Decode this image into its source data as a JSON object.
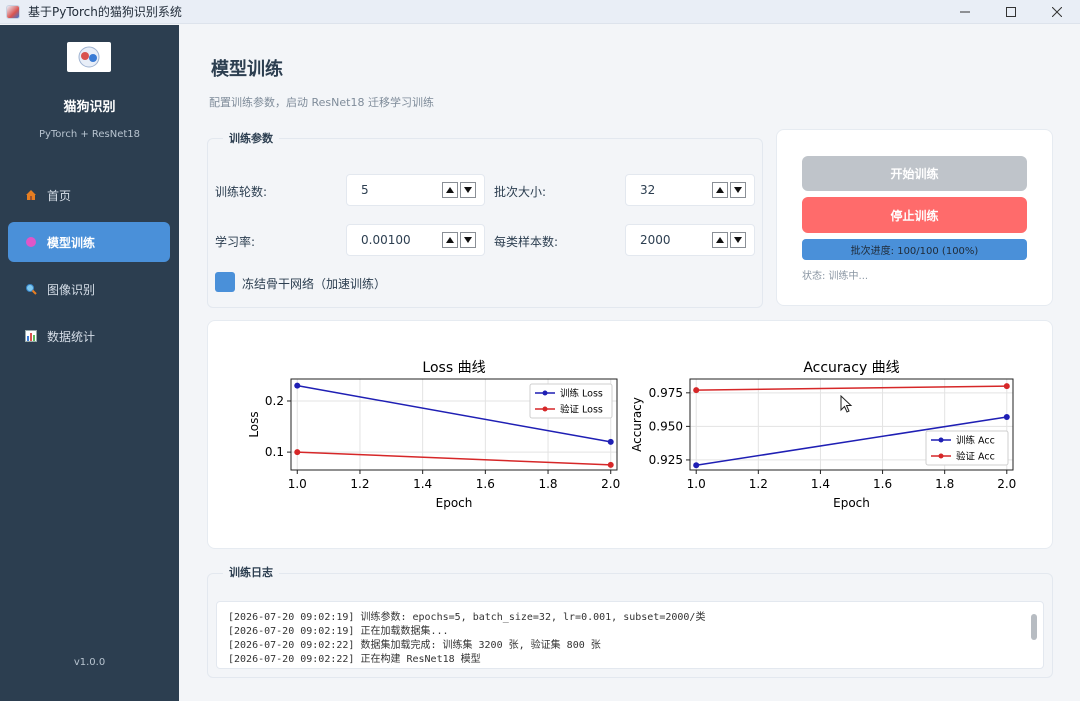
{
  "window": {
    "title": "基于PyTorch的猫狗识别系统"
  },
  "sidebar": {
    "app_name": "猫狗识别",
    "app_subtitle": "PyTorch + ResNet18",
    "items": [
      {
        "label": "首页",
        "icon": "home-icon",
        "active": false
      },
      {
        "label": "模型训练",
        "icon": "circle-icon",
        "active": true
      },
      {
        "label": "图像识别",
        "icon": "magnifier-icon",
        "active": false
      },
      {
        "label": "数据统计",
        "icon": "bar-chart-icon",
        "active": false
      }
    ],
    "version": "v1.0.0"
  },
  "page": {
    "title": "模型训练",
    "subtitle": "配置训练参数，启动 ResNet18 迁移学习训练"
  },
  "params": {
    "group_title": "训练参数",
    "epochs_label": "训练轮数:",
    "epochs_value": "5",
    "batch_label": "批次大小:",
    "batch_value": "32",
    "lr_label": "学习率:",
    "lr_value": "0.00100",
    "samples_label": "每类样本数:",
    "samples_value": "2000",
    "freeze_label": "冻结骨干网络（加速训练）",
    "freeze_checked": true
  },
  "controls": {
    "start_label": "开始训练",
    "stop_label": "停止训练",
    "progress_text": "批次进度: 100/100 (100%)",
    "progress_fraction": 1.0,
    "status_text": "状态: 训练中..."
  },
  "chart_data": [
    {
      "type": "line",
      "title": "Loss 曲线",
      "xlabel": "Epoch",
      "ylabel": "Loss",
      "x": [
        1.0,
        2.0
      ],
      "xlim": [
        0.98,
        2.02
      ],
      "ylim": [
        0.065,
        0.243
      ],
      "xticks": [
        "1.0",
        "1.2",
        "1.4",
        "1.6",
        "1.8",
        "2.0"
      ],
      "yticks": [
        "0.1",
        "0.2"
      ],
      "grid": true,
      "legend": "top-right",
      "series": [
        {
          "name": "训练 Loss",
          "values": [
            0.23,
            0.12
          ],
          "color": "#1f1fb4"
        },
        {
          "name": "验证 Loss",
          "values": [
            0.1,
            0.075
          ],
          "color": "#d62728"
        }
      ]
    },
    {
      "type": "line",
      "title": "Accuracy 曲线",
      "xlabel": "Epoch",
      "ylabel": "Accuracy",
      "x": [
        1.0,
        2.0
      ],
      "xlim": [
        0.98,
        2.02
      ],
      "ylim": [
        0.9175,
        0.9853
      ],
      "xticks": [
        "1.0",
        "1.2",
        "1.4",
        "1.6",
        "1.8",
        "2.0"
      ],
      "yticks": [
        "0.925",
        "0.950",
        "0.975"
      ],
      "grid": true,
      "legend": "bottom-right",
      "series": [
        {
          "name": "训练 Acc",
          "values": [
            0.921,
            0.957
          ],
          "color": "#1f1fb4"
        },
        {
          "name": "验证 Acc",
          "values": [
            0.977,
            0.98
          ],
          "color": "#d62728"
        }
      ]
    }
  ],
  "log": {
    "group_title": "训练日志",
    "lines": [
      "[2026-07-20 09:02:19] 训练参数: epochs=5, batch_size=32, lr=0.001, subset=2000/类",
      "[2026-07-20 09:02:19] 正在加载数据集...",
      "[2026-07-20 09:02:22] 数据集加载完成: 训练集 3200 张, 验证集 800 张",
      "[2026-07-20 09:02:22] 正在构建 ResNet18 模型"
    ]
  }
}
